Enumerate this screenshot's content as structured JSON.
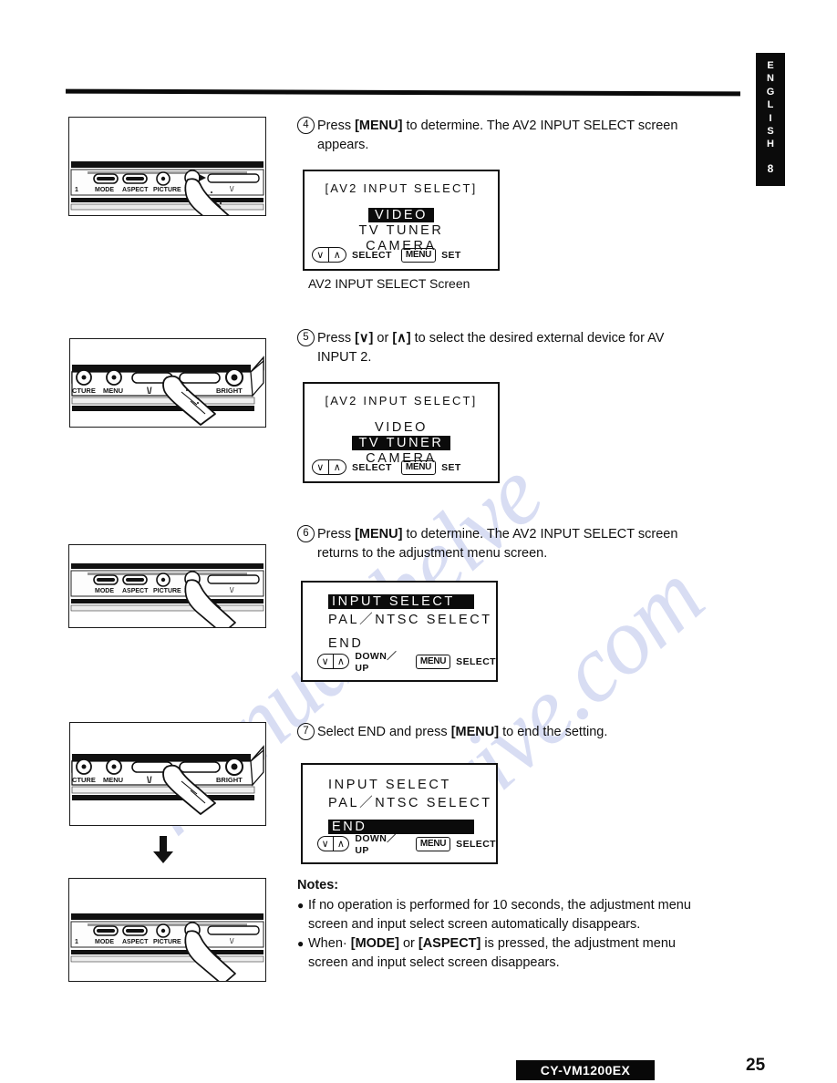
{
  "page": {
    "language_tab": {
      "letters": [
        "E",
        "N",
        "G",
        "L",
        "I",
        "S",
        "H"
      ],
      "section_number": "8"
    },
    "footer_model": "CY-VM1200EX",
    "footer_page_number": "25",
    "watermark": [
      "manualshelve",
      "drive.com"
    ]
  },
  "steps": [
    {
      "number": "4",
      "text_before": "Press ",
      "bold1": "[MENU]",
      "text_mid": " to determine. The AV2 INPUT SELECT screen",
      "line2": "appears.",
      "full": "Press [MENU] to determine. The AV2 INPUT SELECT screen appears."
    },
    {
      "number": "5",
      "full": "Press [V] or [A] to select the desired external device for AV INPUT 2.",
      "line1_a": "Press ",
      "key1": "[∨]",
      "line1_b": " or ",
      "key2": "[∧]",
      "line1_c": " to select the desired external device for AV",
      "line2": "INPUT 2."
    },
    {
      "number": "6",
      "text_before": "Press ",
      "bold1": "[MENU]",
      "text_mid": " to determine. The AV2 INPUT SELECT screen",
      "line2": "returns to the adjustment menu screen.",
      "full": "Press [MENU] to determine. The AV2 INPUT SELECT screen returns to the adjustment menu screen."
    },
    {
      "number": "7",
      "text_before": "Select END and press ",
      "bold1": "[MENU]",
      "text_mid": " to end the setting.",
      "full": "Select END and press [MENU] to end the setting."
    }
  ],
  "osd_screens": [
    {
      "id": "av2-input-select-video",
      "title": "[AV2 INPUT SELECT]",
      "rows": [
        {
          "label": "VIDEO",
          "highlighted": true
        },
        {
          "label": "TV  TUNER",
          "highlighted": false
        },
        {
          "label": "CAMERA",
          "highlighted": false
        }
      ],
      "footer": {
        "key_down": "∨",
        "key_up": "∧",
        "key_label": "SELECT",
        "menu_key": "MENU",
        "menu_label": "SET"
      },
      "caption": "AV2 INPUT SELECT Screen"
    },
    {
      "id": "av2-input-select-tvtuner",
      "title": "[AV2 INPUT SELECT]",
      "rows": [
        {
          "label": "VIDEO",
          "highlighted": false
        },
        {
          "label": "TV  TUNER",
          "highlighted": true
        },
        {
          "label": "CAMERA",
          "highlighted": false
        }
      ],
      "footer": {
        "key_down": "∨",
        "key_up": "∧",
        "key_label": "SELECT",
        "menu_key": "MENU",
        "menu_label": "SET"
      },
      "caption": ""
    },
    {
      "id": "adjustment-menu-input-select",
      "title": "",
      "rows": [
        {
          "label": "INPUT  SELECT",
          "highlighted": true
        },
        {
          "label": "PAL／NTSC  SELECT",
          "highlighted": false
        },
        {
          "label": "END",
          "highlighted": false
        }
      ],
      "footer": {
        "key_down": "∨",
        "key_up": "∧",
        "key_label": "DOWN／UP",
        "menu_key": "MENU",
        "menu_label": "SELECT"
      },
      "caption": ""
    },
    {
      "id": "adjustment-menu-end",
      "title": "",
      "rows": [
        {
          "label": "INPUT  SELECT",
          "highlighted": false
        },
        {
          "label": "PAL／NTSC  SELECT",
          "highlighted": false
        },
        {
          "label": "END",
          "highlighted": true
        }
      ],
      "footer": {
        "key_down": "∨",
        "key_up": "∧",
        "key_label": "DOWN／UP",
        "menu_key": "MENU",
        "menu_label": "SELECT"
      },
      "caption": ""
    }
  ],
  "illustrations": [
    {
      "id": "front-panel-menu-press-1",
      "button_labels": [
        "MODE",
        "ASPECT",
        "PICTURE",
        "MENU"
      ],
      "pressed_button": "MENU"
    },
    {
      "id": "front-panel-down-press",
      "button_labels": [
        "PICTURE",
        "MENU",
        "∨",
        "BRIGHT"
      ],
      "pressed_button": "∨"
    },
    {
      "id": "front-panel-menu-press-2",
      "button_labels": [
        "MODE",
        "ASPECT",
        "PICTURE",
        "MENU"
      ],
      "pressed_button": "MENU"
    },
    {
      "id": "front-panel-down-press-2",
      "button_labels": [
        "PICTURE",
        "MENU",
        "∨",
        "BRIGHT"
      ],
      "pressed_button": "∨"
    },
    {
      "id": "front-panel-menu-press-3",
      "button_labels": [
        "MODE",
        "ASPECT",
        "PICTURE",
        "MENU"
      ],
      "pressed_button": "MENU"
    }
  ],
  "notes": {
    "heading": "Notes:",
    "items": [
      {
        "line1": "If no operation is performed for 10 seconds, the adjustment menu",
        "line2": "screen and input select screen automatically disappears.",
        "full": "If no operation is performed for 10 seconds, the adjustment menu screen and input select screen automatically disappears."
      },
      {
        "prefix": "When· ",
        "bold1": "[MODE]",
        "mid": " or ",
        "bold2": "[ASPECT]",
        "suffix": " is pressed, the adjustment menu",
        "line2": "screen and input select screen disappears.",
        "full": "When [MODE] or [ASPECT] is pressed, the adjustment menu screen and input select screen disappears."
      }
    ]
  }
}
